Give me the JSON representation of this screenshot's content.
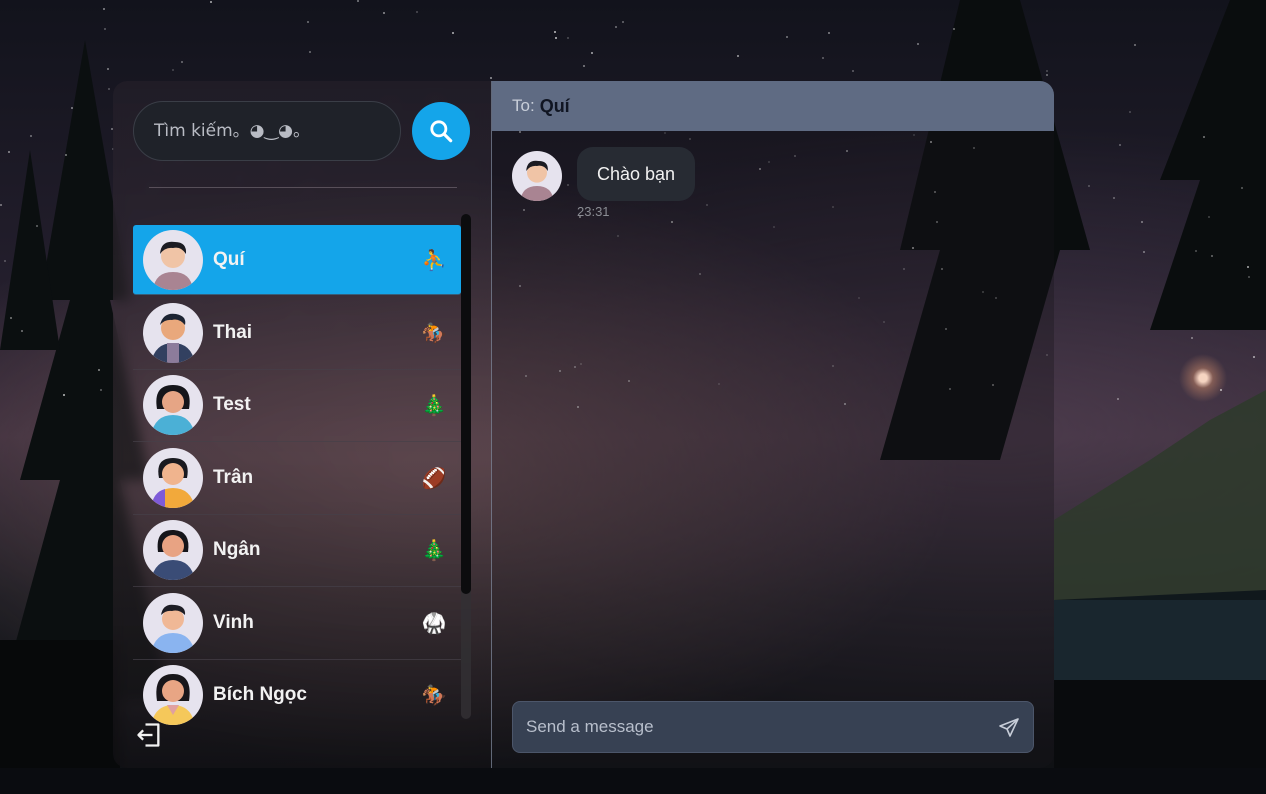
{
  "search": {
    "placeholder": "Tìm kiếm。◕‿◕。"
  },
  "contacts": [
    {
      "name": "Quí",
      "emoji": "⛹",
      "active": true
    },
    {
      "name": "Thai",
      "emoji": "🏇",
      "active": false
    },
    {
      "name": "Test",
      "emoji": "🎄",
      "active": false
    },
    {
      "name": "Trân",
      "emoji": "🏈",
      "active": false
    },
    {
      "name": "Ngân",
      "emoji": "🎄",
      "active": false
    },
    {
      "name": "Vinh",
      "emoji": "🥋",
      "active": false
    },
    {
      "name": "Bích Ngọc",
      "emoji": "🏇",
      "active": false
    }
  ],
  "chat": {
    "to_label": "To:",
    "recipient": "Quí",
    "messages": [
      {
        "text": "Chào bạn",
        "time": "23:31"
      }
    ]
  },
  "composer": {
    "placeholder": "Send a message"
  },
  "colors": {
    "accent": "#14a5ea",
    "header": "#5f6b83",
    "bubble": "#272b33",
    "composer": "#374153"
  },
  "icons": {
    "search": "search-icon",
    "logout": "logout-icon",
    "send": "send-icon"
  }
}
